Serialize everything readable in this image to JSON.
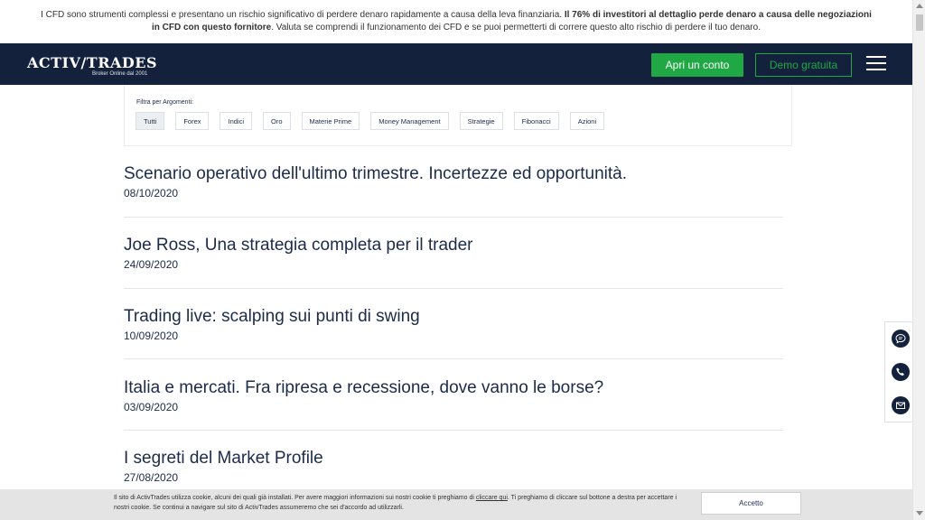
{
  "risk_banner": {
    "text_pre": "I CFD sono strumenti complessi e presentano un rischio significativo di perdere denaro rapidamente a causa della leva finanziaria. ",
    "text_bold": "Il 76% di investitori al dettaglio perde denaro a causa delle negoziazioni in CFD con questo fornitore",
    "text_post": ". Valuta se comprendi il funzionamento dei CFD e se puoi permetterti di correre questo alto rischio di perdere il tuo denaro."
  },
  "header": {
    "logo_text": "ACTIV/TRADES",
    "logo_tagline": "Broker Online dal 2001",
    "open_account_label": "Apri un conto",
    "demo_label": "Demo gratuita"
  },
  "filter": {
    "label": "Filtra per Argomenti:",
    "chips": [
      "Tutti",
      "Forex",
      "Indici",
      "Oro",
      "Materie Prime",
      "Money Management",
      "Strategie",
      "Fibonacci",
      "Azioni"
    ],
    "active": "Tutti"
  },
  "articles": [
    {
      "title": "Scenario operativo dell'ultimo trimestre. Incertezze ed opportunità.",
      "date": "08/10/2020"
    },
    {
      "title": "Joe Ross, Una strategia completa per il trader",
      "date": "24/09/2020"
    },
    {
      "title": "Trading live: scalping sui punti di swing",
      "date": "10/09/2020"
    },
    {
      "title": "Italia e mercati. Fra ripresa e recessione, dove vanno le borse?",
      "date": "03/09/2020"
    },
    {
      "title": "I segreti del Market Profile",
      "date": "27/08/2020"
    }
  ],
  "side_widget": {
    "icons": [
      "chat-icon",
      "phone-icon",
      "mail-icon"
    ]
  },
  "cookie": {
    "text_pre": "Il sito di ActivTrades utilizza cookie, alcuni dei quali già installati. Per avere maggiori informazioni sui nostri cookie ti preghiamo di ",
    "link": "cliccare qui",
    "text_post": ". Ti preghiamo di cliccare sul bottone a destra per accettare i nostri cookie. Se continui a navigare sul sito di ActivTrades assumeremo che sei d'accordo ad utilizzarli.",
    "accept_label": "Accetto"
  },
  "colors": {
    "navy": "#14213d",
    "green": "#1fa844",
    "text": "#1c2b4a"
  }
}
